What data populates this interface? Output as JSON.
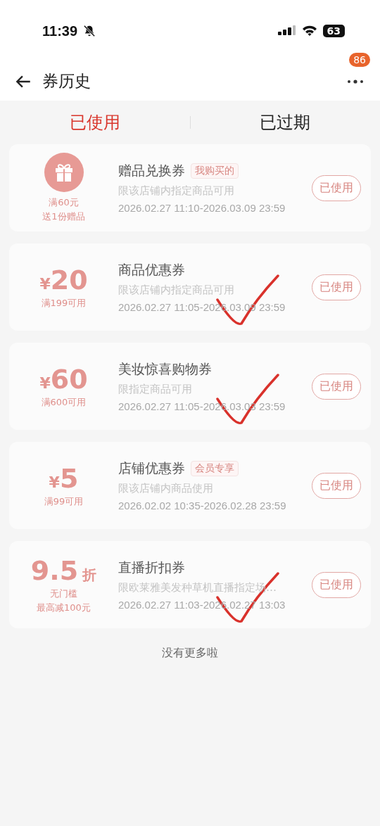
{
  "status_bar": {
    "time": "11:39",
    "battery": "63"
  },
  "header": {
    "title": "券历史",
    "badge": "86"
  },
  "tabs": [
    {
      "label": "已使用",
      "selected": true
    },
    {
      "label": "已过期",
      "selected": false
    }
  ],
  "coupons": [
    {
      "kind": "gift",
      "lines": [
        "满60元",
        "送1份赠品"
      ],
      "title": "赠品兑换券",
      "tag": "我购买的",
      "scope": "限该店铺内指定商品可用",
      "period": "2026.02.27 11:10-2026.03.09 23:59",
      "status": "已使用",
      "ticked": false
    },
    {
      "kind": "amount",
      "currency": "¥",
      "value": "20",
      "lines": [
        "满199可用"
      ],
      "title": "商品优惠券",
      "scope": "限该店铺内指定商品可用",
      "period": "2026.02.27 11:05-2026.03.09 23:59",
      "status": "已使用",
      "ticked": true
    },
    {
      "kind": "amount",
      "currency": "¥",
      "value": "60",
      "lines": [
        "满600可用"
      ],
      "title": "美妆惊喜购物券",
      "scope": "限指定商品可用",
      "period": "2026.02.27 11:05-2026.03.03 23:59",
      "status": "已使用",
      "ticked": true
    },
    {
      "kind": "amount",
      "currency": "¥",
      "value": "5",
      "lines": [
        "满99可用"
      ],
      "title": "店铺优惠券",
      "tag": "会员专享",
      "scope": "限该店铺内商品使用",
      "period": "2026.02.02 10:35-2026.02.28 23:59",
      "status": "已使用",
      "ticked": false
    },
    {
      "kind": "discount",
      "value": "9.5",
      "unit": "折",
      "lines": [
        "无门槛",
        "最高减100元"
      ],
      "title": "直播折扣券",
      "scope": "限欧莱雅美发种草机直播指定场…",
      "period": "2026.02.27 11:03-2026.02.27 13:03",
      "status": "已使用",
      "ticked": true
    }
  ],
  "footer": "没有更多啦"
}
